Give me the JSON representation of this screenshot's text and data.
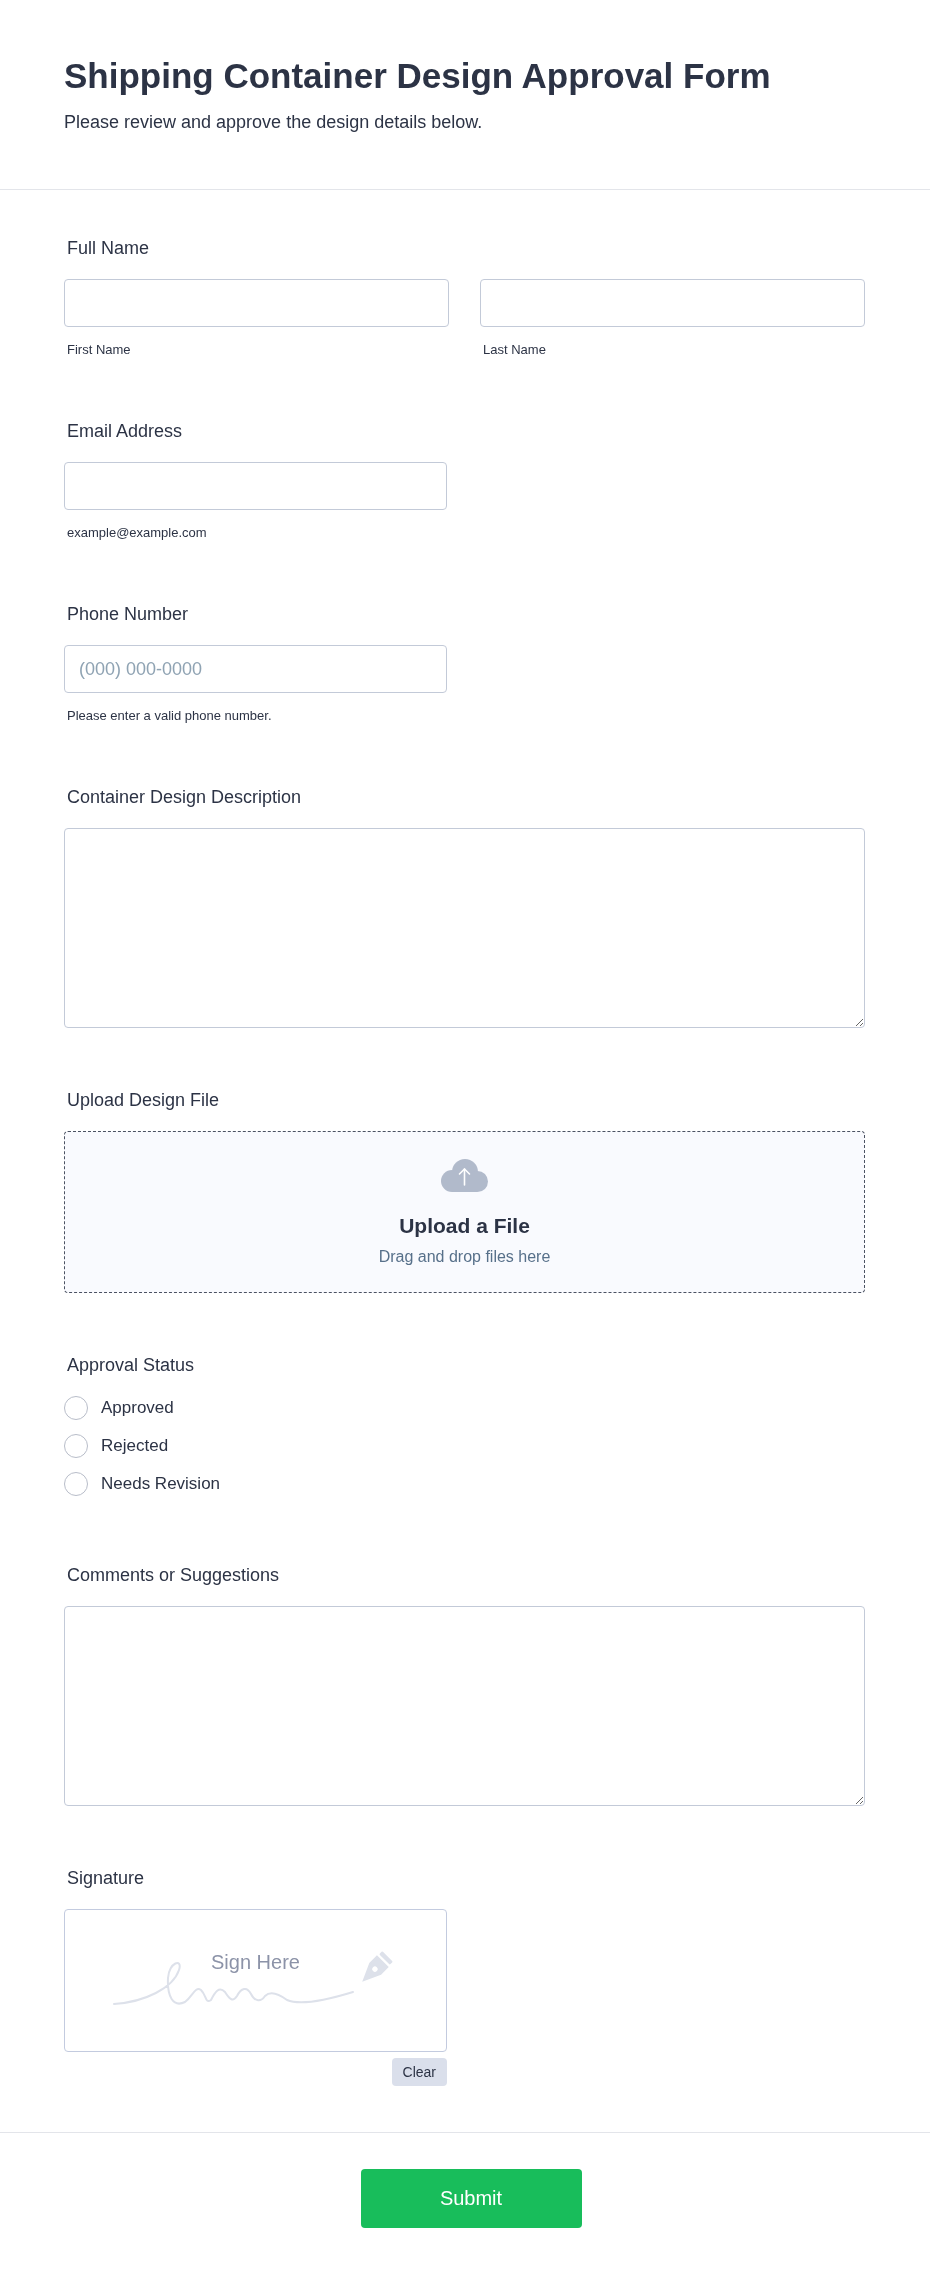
{
  "header": {
    "title": "Shipping Container Design Approval Form",
    "subtitle": "Please review and approve the design details below."
  },
  "fields": [
    {
      "kind": "name",
      "label": "Full Name",
      "parts": [
        {
          "sublabel": "First Name"
        },
        {
          "sublabel": "Last Name"
        }
      ]
    },
    {
      "kind": "text",
      "label": "Email Address",
      "hint": "example@example.com"
    },
    {
      "kind": "text",
      "label": "Phone Number",
      "placeholder": "(000) 000-0000",
      "hint": "Please enter a valid phone number."
    },
    {
      "kind": "textarea",
      "label": "Container Design Description"
    },
    {
      "kind": "upload",
      "label": "Upload Design File",
      "title": "Upload a File",
      "hint": "Drag and drop files here"
    },
    {
      "kind": "radio",
      "label": "Approval Status",
      "options": [
        {
          "label": "Approved",
          "selected": false
        },
        {
          "label": "Rejected",
          "selected": false
        },
        {
          "label": "Needs Revision",
          "selected": false
        }
      ]
    },
    {
      "kind": "textarea",
      "label": "Comments or Suggestions"
    },
    {
      "kind": "signature",
      "label": "Signature",
      "placeholder": "Sign Here",
      "button": "Clear"
    }
  ],
  "submit": {
    "label": "Submit"
  }
}
